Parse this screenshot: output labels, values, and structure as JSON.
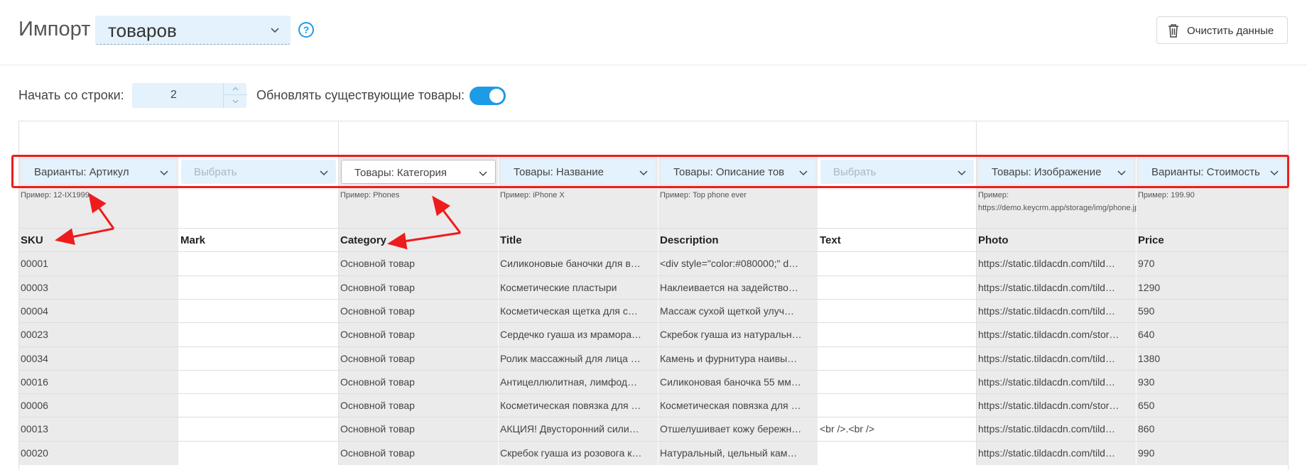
{
  "header": {
    "title": "Импорт",
    "entity_select": "товаров",
    "clear_button": "Очистить данные"
  },
  "options": {
    "start_row_label": "Начать со строки:",
    "start_row_value": "2",
    "update_label": "Обновлять существующие товары:",
    "update_enabled": true
  },
  "mapping": [
    {
      "value": "Варианты: Артикул",
      "placeholder": false,
      "example": "Пример: 12-IX1999"
    },
    {
      "value": "Выбрать",
      "placeholder": true,
      "example": ""
    },
    {
      "value": "Товары: Категория",
      "placeholder": false,
      "example": "Пример: Phones",
      "active": true
    },
    {
      "value": "Товары: Название",
      "placeholder": false,
      "example": "Пример: iPhone X"
    },
    {
      "value": "Товары: Описание тов",
      "placeholder": false,
      "example": "Пример: Top phone ever"
    },
    {
      "value": "Выбрать",
      "placeholder": true,
      "example": ""
    },
    {
      "value": "Товары: Изображение",
      "placeholder": false,
      "example": "Пример: https://demo.keycrm.app/storage/img/phone.jpg"
    },
    {
      "value": "Варианты: Стоимость",
      "placeholder": false,
      "example": "Пример: 199.90"
    }
  ],
  "columns": [
    "SKU",
    "Mark",
    "Category",
    "Title",
    "Description",
    "Text",
    "Photo",
    "Price"
  ],
  "rows": [
    [
      "00001",
      "",
      "Основной товар",
      "Силиконовые баночки для в…",
      "<div style=\"color:#080000;\" d…",
      "",
      "https://static.tildacdn.com/tild…",
      "970"
    ],
    [
      "00003",
      "",
      "Основной товар",
      "Косметические пластыри",
      "Наклеивается на задейство…",
      "",
      "https://static.tildacdn.com/tild…",
      "1290"
    ],
    [
      "00004",
      "",
      "Основной товар",
      "Косметическая щетка для с…",
      "Массаж сухой щеткой улуч…",
      "",
      "https://static.tildacdn.com/tild…",
      "590"
    ],
    [
      "00023",
      "",
      "Основной товар",
      "Сердечко гуаша из мрамора…",
      "Скребок гуаша из натуральн…",
      "",
      "https://static.tildacdn.com/stor…",
      "640"
    ],
    [
      "00034",
      "",
      "Основной товар",
      "Ролик массажный для лица …",
      "Камень и фурнитура наивы…",
      "",
      "https://static.tildacdn.com/tild…",
      "1380"
    ],
    [
      "00016",
      "",
      "Основной товар",
      "Антицеллюлитная, лимфод…",
      "Силиконовая баночка 55 мм…",
      "",
      "https://static.tildacdn.com/tild…",
      "930"
    ],
    [
      "00006",
      "",
      "Основной товар",
      "Косметическая повязка для …",
      "Косметическая повязка для …",
      "",
      "https://static.tildacdn.com/stor…",
      "650"
    ],
    [
      "00013",
      "",
      "Основной товар",
      "АКЦИЯ! Двусторонний сили…",
      "Отшелушивает кожу бережн…",
      "<br />.<br />",
      "https://static.tildacdn.com/tild…",
      "860"
    ],
    [
      "00020",
      "",
      "Основной товар",
      "Скребок гуаша из розовога к…",
      "Натуральный, цельный кам…",
      "",
      "https://static.tildacdn.com/tild…",
      "990"
    ]
  ],
  "colors": {
    "accent": "#1e9be6",
    "annotation": "#ee1c1c",
    "select_bg": "#e3f2fc"
  }
}
